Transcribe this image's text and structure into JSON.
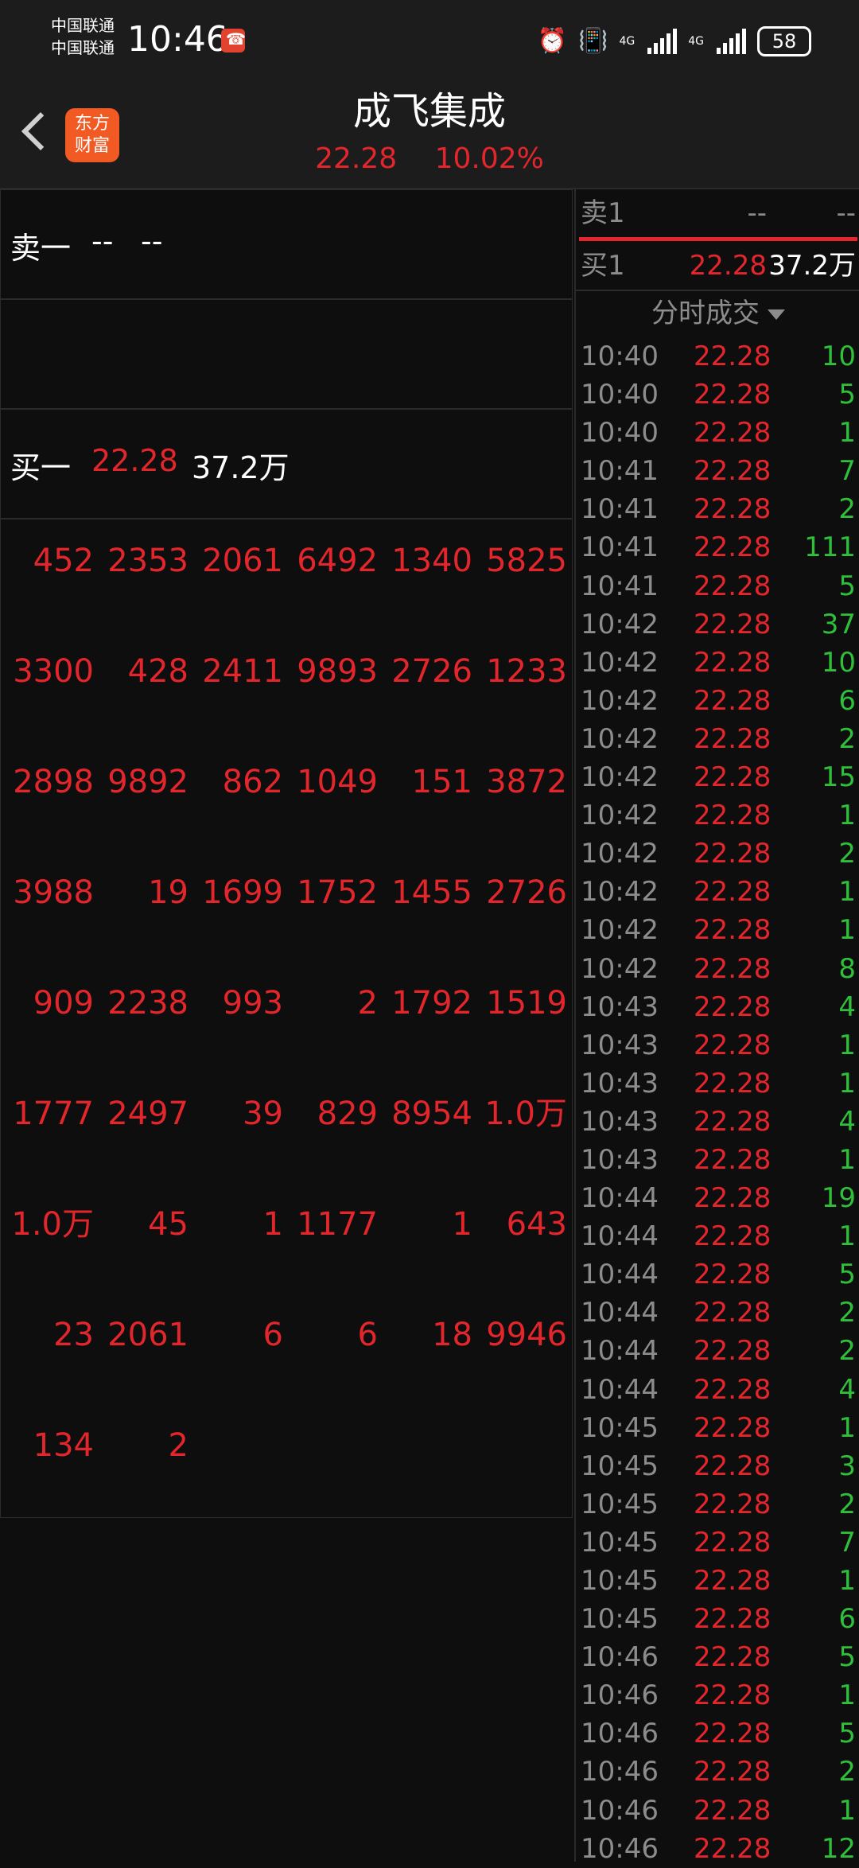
{
  "status_bar": {
    "carrier1": "中国联通",
    "carrier2": "中国联通",
    "time": "10:46",
    "net1": "4G",
    "net2": "4G",
    "battery": "58"
  },
  "header": {
    "title": "成飞集成",
    "price": "22.28",
    "change_pct": "10.02%",
    "logo_line1": "东方",
    "logo_line2": "财富"
  },
  "order_book": {
    "sell1": {
      "label": "卖一",
      "price": "--",
      "volume": "--"
    },
    "buy1": {
      "label": "买一",
      "price": "22.28",
      "volume": "37.2万"
    }
  },
  "queue": [
    "452",
    "2353",
    "2061",
    "6492",
    "1340",
    "5825",
    "3300",
    "428",
    "2411",
    "9893",
    "2726",
    "1233",
    "2898",
    "9892",
    "862",
    "1049",
    "151",
    "3872",
    "3988",
    "19",
    "1699",
    "1752",
    "1455",
    "2726",
    "909",
    "2238",
    "993",
    "2",
    "1792",
    "1519",
    "1777",
    "2497",
    "39",
    "829",
    "8954",
    "1.0万",
    "1.0万",
    "45",
    "1",
    "1177",
    "1",
    "643",
    "23",
    "2061",
    "6",
    "6",
    "18",
    "9946",
    "134",
    "2"
  ],
  "right_panel": {
    "sell1": {
      "label": "卖1",
      "price": "--",
      "volume": "--"
    },
    "buy1": {
      "label": "买1",
      "price": "22.28",
      "volume": "37.2万"
    },
    "ticks_header": "分时成交",
    "ticks": [
      [
        "10:40",
        "22.28",
        "10"
      ],
      [
        "10:40",
        "22.28",
        "5"
      ],
      [
        "10:40",
        "22.28",
        "1"
      ],
      [
        "10:41",
        "22.28",
        "7"
      ],
      [
        "10:41",
        "22.28",
        "2"
      ],
      [
        "10:41",
        "22.28",
        "111"
      ],
      [
        "10:41",
        "22.28",
        "5"
      ],
      [
        "10:42",
        "22.28",
        "37"
      ],
      [
        "10:42",
        "22.28",
        "10"
      ],
      [
        "10:42",
        "22.28",
        "6"
      ],
      [
        "10:42",
        "22.28",
        "2"
      ],
      [
        "10:42",
        "22.28",
        "15"
      ],
      [
        "10:42",
        "22.28",
        "1"
      ],
      [
        "10:42",
        "22.28",
        "2"
      ],
      [
        "10:42",
        "22.28",
        "1"
      ],
      [
        "10:42",
        "22.28",
        "1"
      ],
      [
        "10:42",
        "22.28",
        "8"
      ],
      [
        "10:43",
        "22.28",
        "4"
      ],
      [
        "10:43",
        "22.28",
        "1"
      ],
      [
        "10:43",
        "22.28",
        "1"
      ],
      [
        "10:43",
        "22.28",
        "4"
      ],
      [
        "10:43",
        "22.28",
        "1"
      ],
      [
        "10:44",
        "22.28",
        "19"
      ],
      [
        "10:44",
        "22.28",
        "1"
      ],
      [
        "10:44",
        "22.28",
        "5"
      ],
      [
        "10:44",
        "22.28",
        "2"
      ],
      [
        "10:44",
        "22.28",
        "2"
      ],
      [
        "10:44",
        "22.28",
        "4"
      ],
      [
        "10:45",
        "22.28",
        "1"
      ],
      [
        "10:45",
        "22.28",
        "3"
      ],
      [
        "10:45",
        "22.28",
        "2"
      ],
      [
        "10:45",
        "22.28",
        "7"
      ],
      [
        "10:45",
        "22.28",
        "1"
      ],
      [
        "10:45",
        "22.28",
        "6"
      ],
      [
        "10:46",
        "22.28",
        "5"
      ],
      [
        "10:46",
        "22.28",
        "1"
      ],
      [
        "10:46",
        "22.28",
        "5"
      ],
      [
        "10:46",
        "22.28",
        "2"
      ],
      [
        "10:46",
        "22.28",
        "1"
      ],
      [
        "10:46",
        "22.28",
        "12"
      ]
    ]
  },
  "colors": {
    "up": "#e3262b",
    "down": "#2fbf3a",
    "muted": "#8c8c8c",
    "bg": "#0e0e0e",
    "bar": "#1c1c1c"
  }
}
